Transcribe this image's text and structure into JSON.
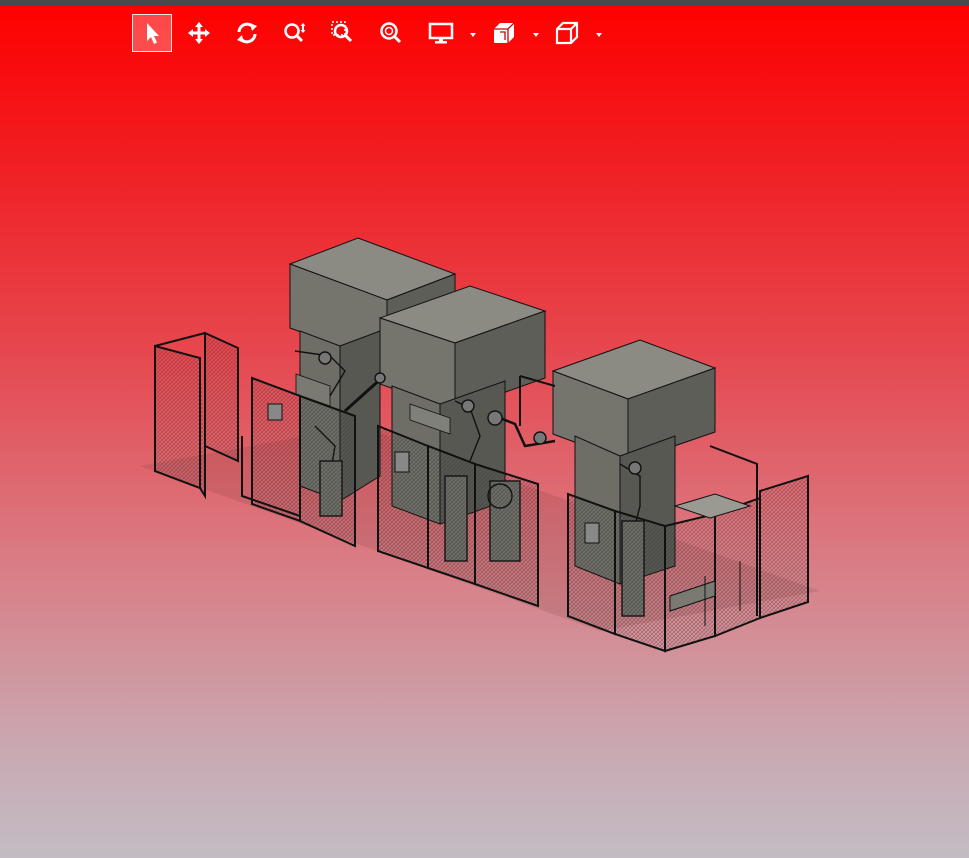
{
  "window": {
    "title": ""
  },
  "colors": {
    "background_top": "#ff0000",
    "background_bottom": "#c3bcc4",
    "accent": "#ffffff",
    "machine_body": "#8a8a80",
    "fence_line": "#111111"
  },
  "toolbar": {
    "tools": [
      {
        "name": "select",
        "icon": "pointer-arrow-icon",
        "active": true
      },
      {
        "name": "pan",
        "icon": "four-way-arrow-icon",
        "active": false
      },
      {
        "name": "rotate",
        "icon": "rotate-icon",
        "active": false
      },
      {
        "name": "zoom",
        "icon": "zoom-icon",
        "active": false
      },
      {
        "name": "zoom-window",
        "icon": "zoom-window-icon",
        "active": false
      },
      {
        "name": "zoom-fit",
        "icon": "zoom-fit-icon",
        "active": false
      },
      {
        "name": "display",
        "icon": "monitor-icon",
        "active": false,
        "dropdown": true
      },
      {
        "name": "section",
        "icon": "section-box-icon",
        "active": false,
        "dropdown": true
      },
      {
        "name": "view",
        "icon": "cube-icon",
        "active": false,
        "dropdown": true
      }
    ]
  },
  "model": {
    "description_icon": "3d-assembly-icon"
  }
}
